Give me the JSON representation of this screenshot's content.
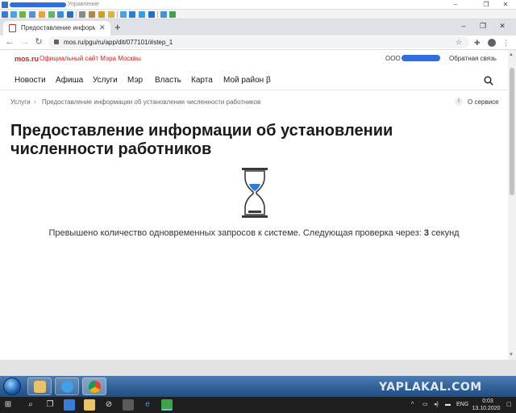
{
  "remote_window": {
    "title": "Управление",
    "controls": [
      "–",
      "❐",
      "✕"
    ]
  },
  "browser": {
    "tab_title": "Предоставление информации об",
    "tab_close": "✕",
    "new_tab": "+",
    "url": "mos.ru/pgu/ru/app/dit/077101/#step_1",
    "window_controls": [
      "–",
      "❐",
      "✕"
    ]
  },
  "site": {
    "logo": "mos.ru",
    "logo_subtitle": "Официальный сайт Мэра Москвы",
    "org_prefix": "ООО",
    "feedback": "Обратная связь",
    "nav": [
      "Новости",
      "Афиша",
      "Услуги",
      "Мэр",
      "Власть",
      "Карта",
      "Мой район β"
    ],
    "breadcrumb": [
      "Услуги",
      "Предоставление информации об установлении численности работников"
    ],
    "about": "О сервисе",
    "info_glyph": "i"
  },
  "page": {
    "title": "Предоставление информации об установлении численности работников",
    "message_prefix": "Превышено количество одновременных запросов к системе. Следующая проверка через: ",
    "countdown": "3",
    "message_suffix": " секунд"
  },
  "taskbar": {
    "watermark": "YAPLAKAL.COM",
    "language": "ENG",
    "time": "0:03",
    "date": "13.10.2020"
  },
  "colors": {
    "brand_red": "#cc2222",
    "hourglass_blue": "#2f7bd9",
    "redaction_blue": "#2f6de0"
  }
}
